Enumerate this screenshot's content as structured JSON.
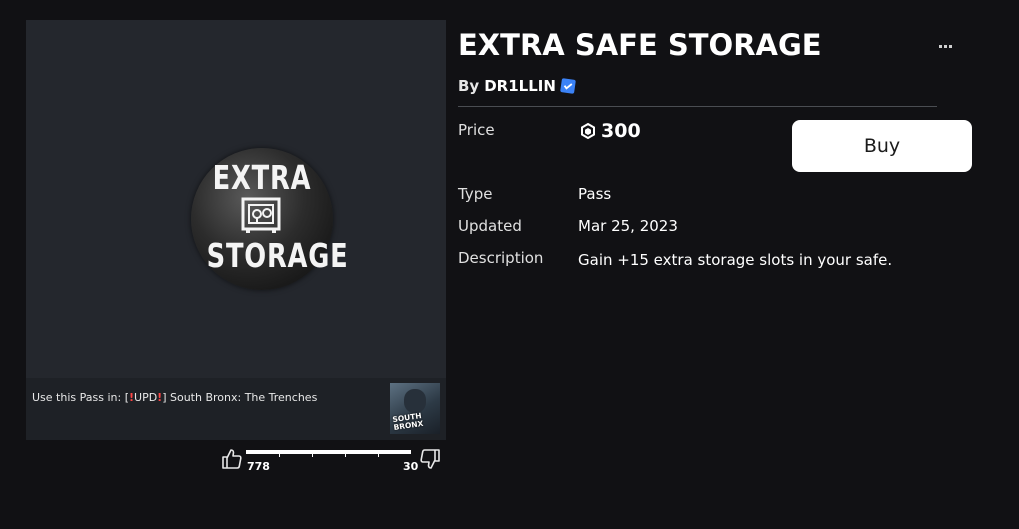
{
  "thumbnail": {
    "badge_top": "EXTRA",
    "badge_bottom": "STORAGE"
  },
  "use_in": {
    "prefix": "Use this Pass in: ",
    "game_bracket_open": "[",
    "game_excl_1": "!",
    "game_tag": "UPD",
    "game_excl_2": "!",
    "game_bracket_close": "] South Bronx: The Trenches",
    "game_thumb_label_1": "SOUTH",
    "game_thumb_label_2": "BRONX"
  },
  "votes": {
    "up_count": "778",
    "down_count": "30",
    "up_fraction": 0.963
  },
  "item": {
    "title": "EXTRA SAFE STORAGE",
    "by_prefix": "By",
    "creator": "DR1LLIN"
  },
  "details": {
    "price_label": "Price",
    "price_value": "300",
    "type_label": "Type",
    "type_value": "Pass",
    "updated_label": "Updated",
    "updated_value": "Mar 25, 2023",
    "description_label": "Description",
    "description_value": "Gain +15 extra storage slots in your safe."
  },
  "actions": {
    "buy_label": "Buy"
  },
  "colors": {
    "background": "#111114",
    "card": "#24272d",
    "verified": "#3b82f6",
    "accent_red": "#ff4545"
  },
  "icons": [
    "robux-icon",
    "verified-badge-icon",
    "thumbs-up-icon",
    "thumbs-down-icon",
    "more-options-icon",
    "safe-icon"
  ]
}
